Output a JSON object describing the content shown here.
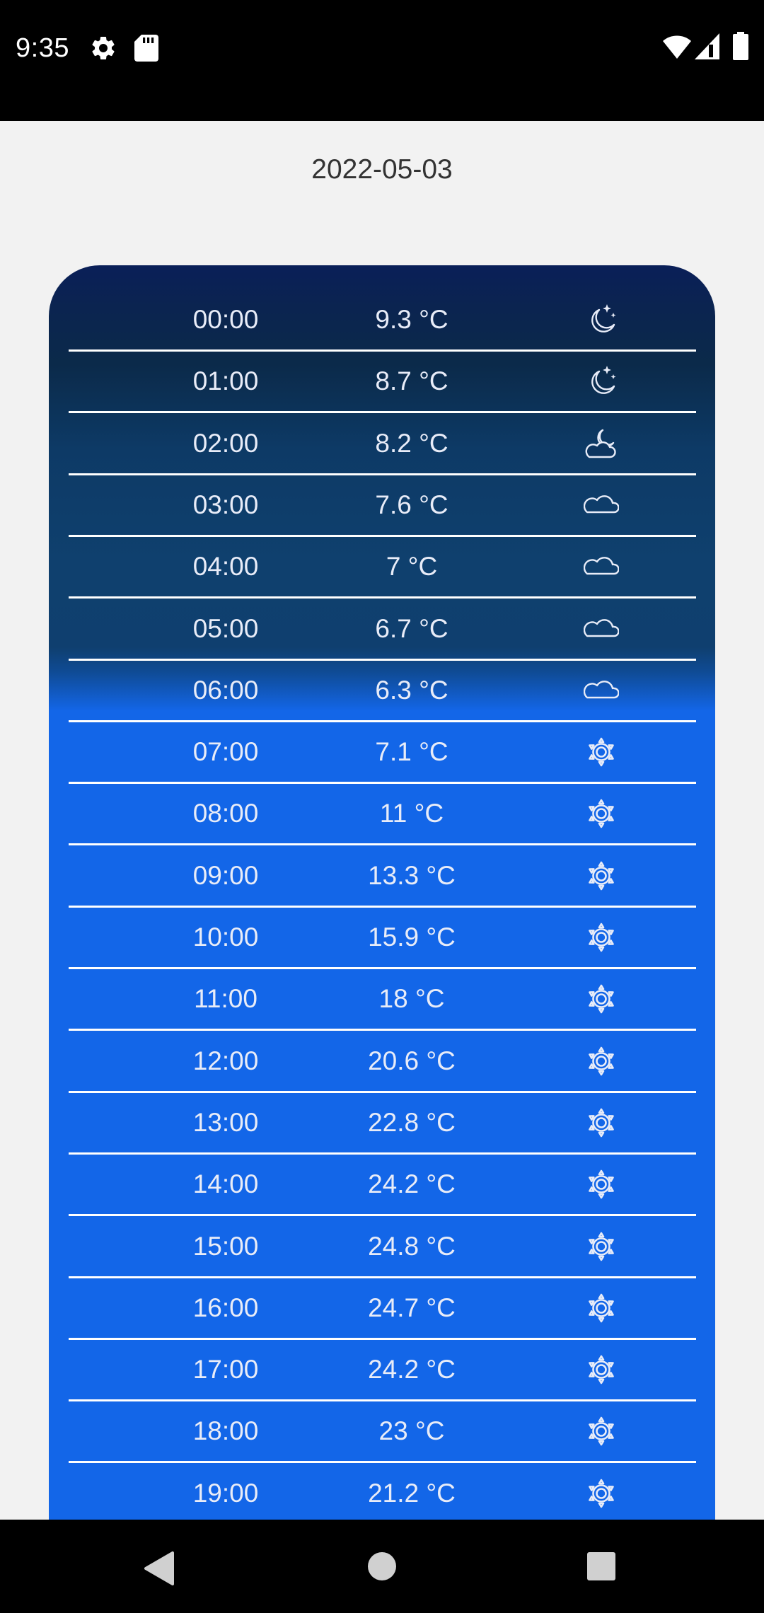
{
  "status_bar": {
    "time": "9:35",
    "icons": [
      "settings-icon",
      "sd-card-icon",
      "wifi-icon",
      "cellular-signal-icon",
      "battery-icon"
    ]
  },
  "header": {
    "date": "2022-05-03"
  },
  "forecast": {
    "hours": [
      {
        "time": "00:00",
        "temp": "9.3 °C",
        "icon": "moon-stars-icon"
      },
      {
        "time": "01:00",
        "temp": "8.7 °C",
        "icon": "moon-stars-icon"
      },
      {
        "time": "02:00",
        "temp": "8.2 °C",
        "icon": "cloud-moon-icon"
      },
      {
        "time": "03:00",
        "temp": "7.6 °C",
        "icon": "cloud-icon"
      },
      {
        "time": "04:00",
        "temp": "7 °C",
        "icon": "cloud-icon"
      },
      {
        "time": "05:00",
        "temp": "6.7 °C",
        "icon": "cloud-icon"
      },
      {
        "time": "06:00",
        "temp": "6.3 °C",
        "icon": "cloud-icon"
      },
      {
        "time": "07:00",
        "temp": "7.1 °C",
        "icon": "sun-icon"
      },
      {
        "time": "08:00",
        "temp": "11 °C",
        "icon": "sun-icon"
      },
      {
        "time": "09:00",
        "temp": "13.3 °C",
        "icon": "sun-icon"
      },
      {
        "time": "10:00",
        "temp": "15.9 °C",
        "icon": "sun-icon"
      },
      {
        "time": "11:00",
        "temp": "18 °C",
        "icon": "sun-icon"
      },
      {
        "time": "12:00",
        "temp": "20.6 °C",
        "icon": "sun-icon"
      },
      {
        "time": "13:00",
        "temp": "22.8 °C",
        "icon": "sun-icon"
      },
      {
        "time": "14:00",
        "temp": "24.2 °C",
        "icon": "sun-icon"
      },
      {
        "time": "15:00",
        "temp": "24.8 °C",
        "icon": "sun-icon"
      },
      {
        "time": "16:00",
        "temp": "24.7 °C",
        "icon": "sun-icon"
      },
      {
        "time": "17:00",
        "temp": "24.2 °C",
        "icon": "sun-icon"
      },
      {
        "time": "18:00",
        "temp": "23 °C",
        "icon": "sun-icon"
      },
      {
        "time": "19:00",
        "temp": "21.2 °C",
        "icon": "sun-icon"
      }
    ]
  },
  "nav_bar": {
    "buttons": [
      "back-icon",
      "home-icon",
      "recents-icon"
    ]
  },
  "colors": {
    "night_top": "#0a1f58",
    "night_mid": "#0f406e",
    "day": "#1366e8",
    "page_background": "#f2f2f2",
    "bars": "#000000"
  }
}
